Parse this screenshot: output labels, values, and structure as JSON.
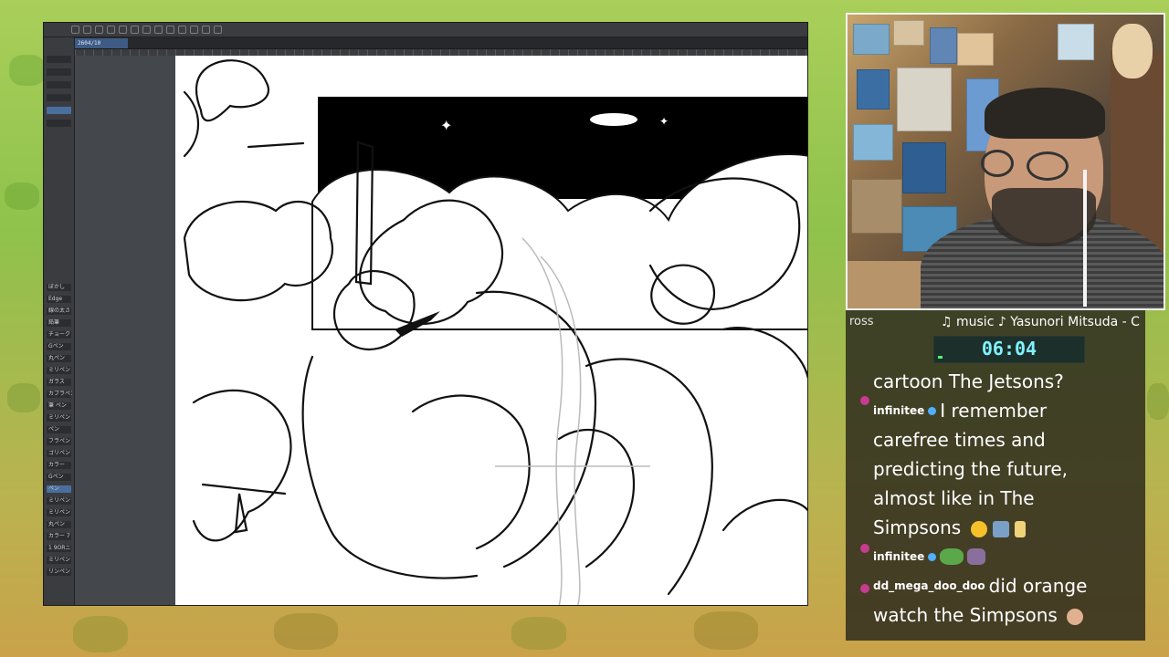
{
  "app": {
    "document_tab": "2604/10",
    "tool_panel_items": [
      "ぼかし",
      "Edge",
      "線の太さ",
      "鉛筆",
      "チョーク",
      "Gペン",
      "丸ペン",
      "ミリペン",
      "ガラス",
      "カブラペン",
      "筆 ペン",
      "ミリペン",
      "ペン",
      "フラペン",
      "ゴリペン",
      "カラー",
      "Gペン",
      "ペン",
      "ミリペン",
      "ミリペン",
      "丸ペン",
      "カラー 7",
      "1 9ORニ",
      "ミリペン",
      "リンペン"
    ],
    "colors": {
      "app_bg": "#2f3134",
      "accent": "#4a6f9e"
    }
  },
  "overlay": {
    "left_label": "ross",
    "music_line": "♫ music ♪ Yasunori Mitsuda - C",
    "timer": "06:04",
    "timer_progress": 0.03,
    "chat": [
      {
        "type": "text",
        "text": "cartoon The Jetsons?"
      },
      {
        "type": "message",
        "user": "infinitee",
        "text": "I remember"
      },
      {
        "type": "text",
        "text": "carefree times and"
      },
      {
        "type": "text",
        "text": "predicting the future,"
      },
      {
        "type": "text",
        "text": "almost like in The"
      },
      {
        "type": "text",
        "text": "Simpsons"
      },
      {
        "type": "message",
        "user": "infinitee",
        "text": ""
      },
      {
        "type": "message",
        "user": "dd_mega_doo_doo",
        "text": "did orange"
      },
      {
        "type": "text",
        "text": "watch the Simpsons"
      }
    ],
    "colors": {
      "timer_text": "#7ff2ff",
      "timer_bar": "#4dff6b",
      "badge": "#4fb0ff",
      "mod_badge": "#c93b8f"
    }
  }
}
